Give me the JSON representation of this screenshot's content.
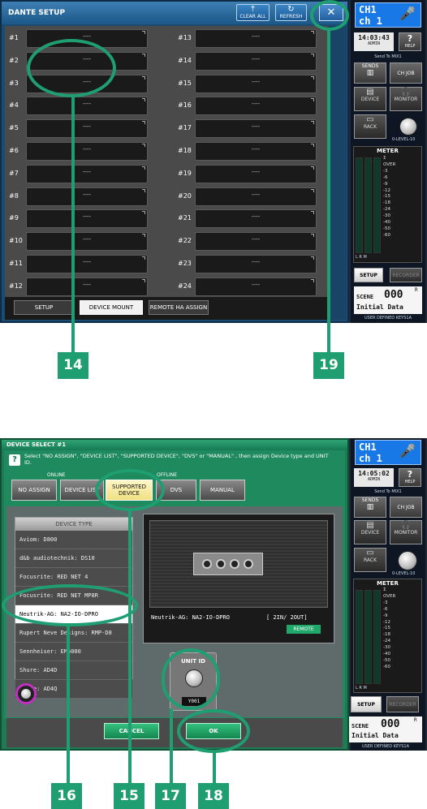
{
  "dante_setup": {
    "title": "DANTE SETUP",
    "clear_all": "CLEAR ALL",
    "refresh": "REFRESH",
    "close": "✕",
    "slots_left": [
      {
        "label": "#1",
        "value": "----"
      },
      {
        "label": "#2",
        "value": "----"
      },
      {
        "label": "#3",
        "value": "----"
      },
      {
        "label": "#4",
        "value": "----"
      },
      {
        "label": "#5",
        "value": "----"
      },
      {
        "label": "#6",
        "value": "----"
      },
      {
        "label": "#7",
        "value": "----"
      },
      {
        "label": "#8",
        "value": "----"
      },
      {
        "label": "#9",
        "value": "----"
      },
      {
        "label": "#10",
        "value": "----"
      },
      {
        "label": "#11",
        "value": "----"
      },
      {
        "label": "#12",
        "value": "----"
      }
    ],
    "slots_right": [
      {
        "label": "#13",
        "value": "----"
      },
      {
        "label": "#14",
        "value": "----"
      },
      {
        "label": "#15",
        "value": "----"
      },
      {
        "label": "#16",
        "value": "----"
      },
      {
        "label": "#17",
        "value": "----"
      },
      {
        "label": "#18",
        "value": "----"
      },
      {
        "label": "#19",
        "value": "----"
      },
      {
        "label": "#20",
        "value": "----"
      },
      {
        "label": "#21",
        "value": "----"
      },
      {
        "label": "#22",
        "value": "----"
      },
      {
        "label": "#23",
        "value": "----"
      },
      {
        "label": "#24",
        "value": "----"
      }
    ],
    "tabs": [
      "SETUP",
      "DEVICE MOUNT",
      "REMOTE HA ASSIGN"
    ],
    "active_tab": "DEVICE MOUNT"
  },
  "side1": {
    "ch_line1": "CH1",
    "ch_line2": "ch 1",
    "time": "14:03:43",
    "user": "ADMIN",
    "help": "HELP",
    "send_to": "Send To MIX1",
    "sends": "SENDS",
    "ch_job": "CH JOB",
    "device": "DEVICE",
    "monitor": "MONITOR",
    "rack": "RACK",
    "level": "0-LEVEL-10",
    "meter": "METER",
    "meter_scale": [
      "Σ",
      "OVER",
      "-3",
      "-6",
      "-9",
      "-12",
      "-15",
      "-18",
      "-24",
      "-30",
      "-40",
      "-50",
      "-60"
    ],
    "meter_lrm": "L  R  M",
    "setup": "SETUP",
    "recorder": "RECORDER",
    "scene_label": "SCENE",
    "scene_num": "000",
    "scene_r": "R",
    "scene_name": "Initial Data",
    "user_keys": "USER DEFINED KEYS1A"
  },
  "device_select": {
    "title": "DEVICE SELECT #1",
    "help_icon": "?",
    "info": "Select \"NO ASSIGN\", \"DEVICE LIST\", \"SUPPORTED DEVICE\", \"DVS\" or  \"MANUAL\" , then assign Device type and UNIT ID.",
    "online_label": "ONLINE",
    "offline_label": "OFFLINE",
    "tabs": [
      "NO ASSIGN",
      "DEVICE LIST",
      "SUPPORTED DEVICE",
      "DVS",
      "MANUAL"
    ],
    "active_tab": "SUPPORTED DEVICE",
    "list_header": "DEVICE TYPE",
    "devices": [
      "Aviom: D800",
      "d&b audiotechnik: DS10",
      "Focusrite: RED NET 4",
      "Focusrite: RED NET MP8R",
      "Neutrik-AG: NA2-IO-DPRO",
      "Rupert Neve Designs: RMP-D8",
      "Sennheiser: EM6000",
      "Shure: AD4D",
      "Shure: AD4Q"
    ],
    "selected_device": "Neutrik-AG: NA2-IO-DPRO",
    "device_name": "Neutrik-AG: NA2-IO-DPRO",
    "device_io": "[ 2IN/ 2OUT]",
    "remote": "REMOTE",
    "unit_id_label": "UNIT ID",
    "unit_id_value": "Y001",
    "cancel": "CANCEL",
    "ok": "OK"
  },
  "side2": {
    "ch_line1": "CH1",
    "ch_line2": "ch 1",
    "time": "14:05:02",
    "user": "ADMIN",
    "help": "HELP",
    "send_to": "Send To MIX1",
    "sends": "SENDS",
    "ch_job": "CH JOB",
    "device": "DEVICE",
    "monitor": "MONITOR",
    "rack": "RACK",
    "level": "0-LEVEL-10",
    "meter": "METER",
    "meter_scale": [
      "Σ",
      "OVER",
      "-3",
      "-6",
      "-9",
      "-12",
      "-15",
      "-18",
      "-24",
      "-30",
      "-40",
      "-50",
      "-60"
    ],
    "meter_lrm": "L  R  M",
    "setup": "SETUP",
    "recorder": "RECORDER",
    "scene_label": "SCENE",
    "scene_num": "000",
    "scene_r": "R",
    "scene_name": "Initial Data",
    "user_keys": "USER DEFINED KEYS1A"
  },
  "callouts": {
    "c14": "14",
    "c19": "19",
    "c16": "16",
    "c15": "15",
    "c17": "17",
    "c18": "18"
  },
  "colors": {
    "callout": "#1f9e72",
    "dante_frame": "#1c4a70",
    "select_frame": "#1f7a55"
  }
}
